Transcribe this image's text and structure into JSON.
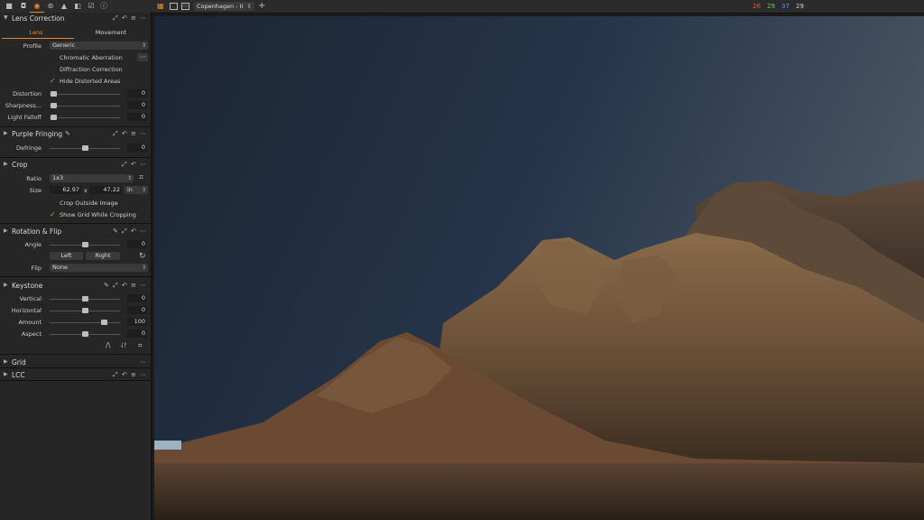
{
  "toolbar": {
    "tools": [
      "library-icon",
      "camera-icon",
      "lens-icon",
      "adjustments-icon",
      "exposure-icon",
      "details-icon",
      "metadata-icon",
      "info-icon"
    ],
    "preset": "Copenhagen - II",
    "counts": [
      {
        "value": "26",
        "color": "#e05a3a"
      },
      {
        "value": "29",
        "color": "#6fcf4e"
      },
      {
        "value": "37",
        "color": "#5a8bff"
      },
      {
        "value": "29",
        "color": "#d0d0d0"
      }
    ]
  },
  "lens": {
    "title": "Lens Correction",
    "tabs": [
      "Lens",
      "Movement"
    ],
    "profile_label": "Profile",
    "profile_value": "Generic",
    "chromatic": "Chromatic Aberration",
    "diffraction": "Diffraction Correction",
    "hide_distorted": "Hide Distorted Areas",
    "distortion_label": "Distortion",
    "distortion_value": "0",
    "sharpness_label": "Sharpness...",
    "sharpness_value": "0",
    "falloff_label": "Light Falloff",
    "falloff_value": "0"
  },
  "purple": {
    "title": "Purple Fringing",
    "defringe_label": "Defringe",
    "defringe_value": "0"
  },
  "crop": {
    "title": "Crop",
    "ratio_label": "Ratio",
    "ratio_value": "1x3",
    "size_label": "Size",
    "width": "62.97",
    "x": "x",
    "height": "47.22",
    "unit": "in",
    "outside": "Crop Outside Image",
    "show_grid": "Show Grid While Cropping"
  },
  "rotation": {
    "title": "Rotation & Flip",
    "angle_label": "Angle",
    "angle_value": "0",
    "left": "Left",
    "right": "Right",
    "flip_label": "Flip",
    "flip_value": "None"
  },
  "keystone": {
    "title": "Keystone",
    "vertical_label": "Vertical",
    "vertical_value": "0",
    "horizontal_label": "Horizontal",
    "horizontal_value": "0",
    "amount_label": "Amount",
    "amount_value": "100",
    "amount_level": 0.77,
    "aspect_label": "Aspect",
    "aspect_value": "0"
  },
  "grid": {
    "title": "Grid"
  },
  "lcc": {
    "title": "LCC"
  },
  "colors": {
    "accent": "#f0892b"
  }
}
